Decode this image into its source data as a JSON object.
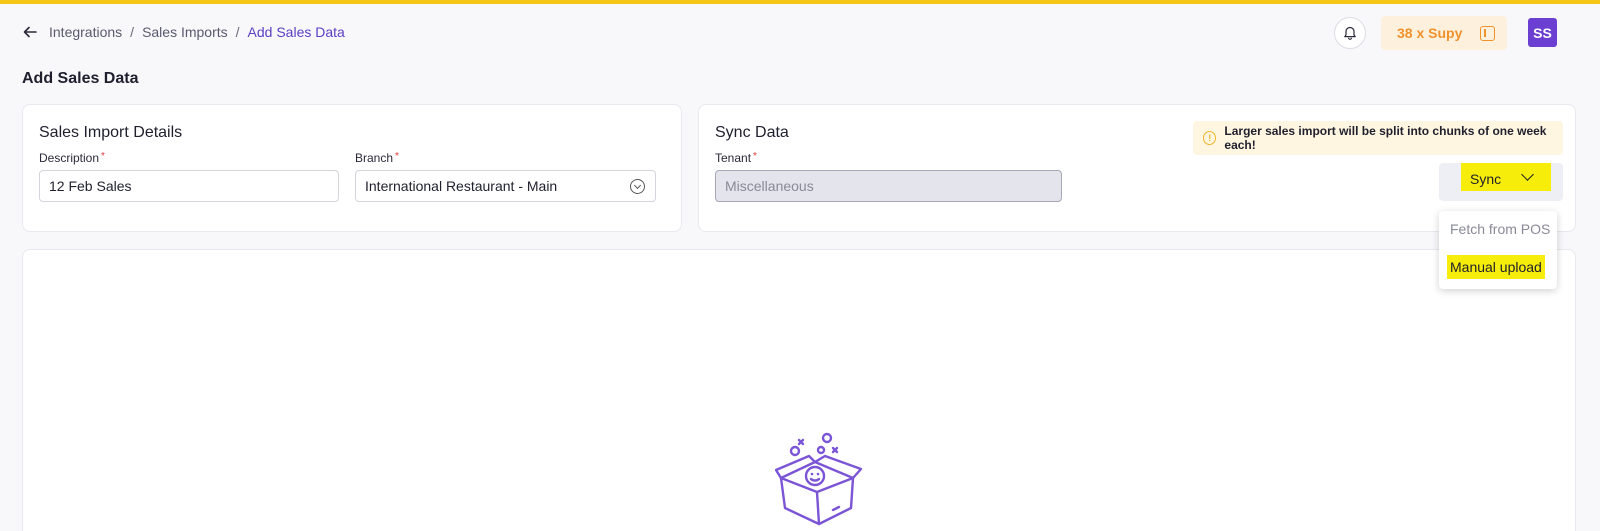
{
  "header": {
    "breadcrumb": [
      "Integrations",
      "Sales Imports",
      "Add Sales Data"
    ],
    "supy_label": "38 x Supy",
    "avatar_initials": "SS"
  },
  "page_title": "Add Sales Data",
  "details": {
    "title": "Sales Import Details",
    "description_label": "Description",
    "description_value": "12 Feb Sales",
    "branch_label": "Branch",
    "branch_value": "International Restaurant - Main"
  },
  "sync": {
    "title": "Sync Data",
    "tenant_label": "Tenant",
    "tenant_value": "Miscellaneous",
    "alert_text": "Larger sales import will be split into chunks of one week each!",
    "button_label": "Sync",
    "menu": [
      "Fetch from POS",
      "Manual upload"
    ]
  },
  "colors": {
    "accent": "#f5c518",
    "brand_purple": "#6a3fd1",
    "highlight": "#f6ee0a",
    "supy_orange": "#f0922b"
  },
  "icons": [
    "back-arrow-icon",
    "bell-icon",
    "panel-icon",
    "chevron-down-icon",
    "info-icon",
    "empty-box-icon"
  ]
}
